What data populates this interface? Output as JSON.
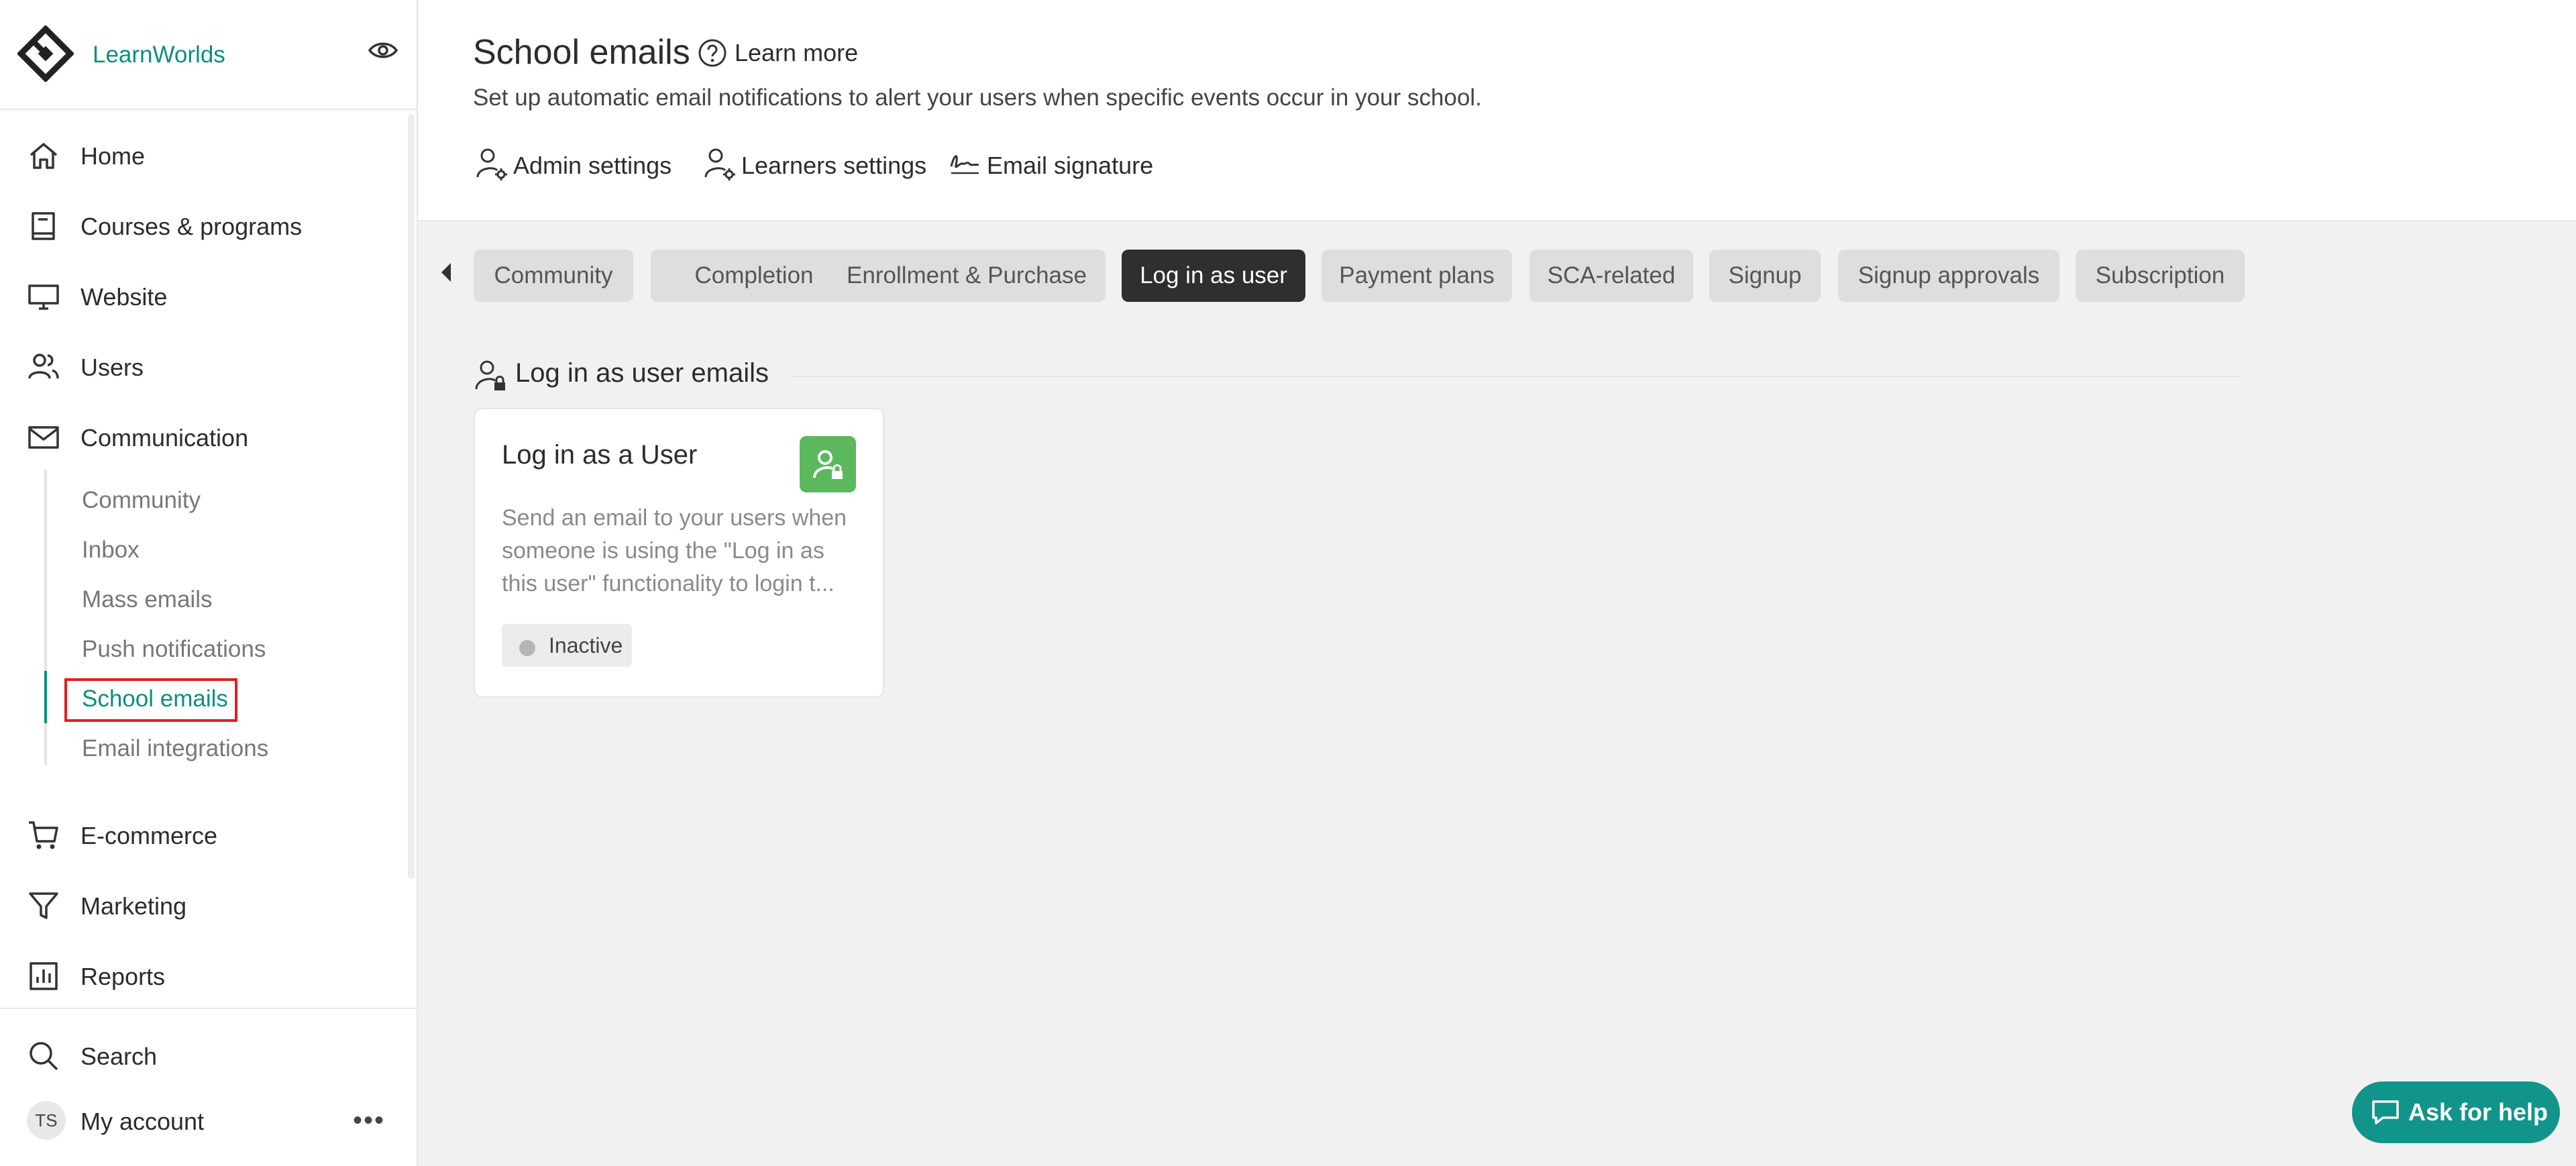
{
  "brand": {
    "name": "LearnWorlds"
  },
  "sidebar": {
    "items": [
      {
        "label": "Home",
        "icon": "home-icon"
      },
      {
        "label": "Courses & programs",
        "icon": "book-icon"
      },
      {
        "label": "Website",
        "icon": "monitor-icon"
      },
      {
        "label": "Users",
        "icon": "users-icon"
      },
      {
        "label": "Communication",
        "icon": "mail-icon"
      },
      {
        "label": "E-commerce",
        "icon": "cart-icon"
      },
      {
        "label": "Marketing",
        "icon": "funnel-icon"
      },
      {
        "label": "Reports",
        "icon": "chart-icon"
      }
    ],
    "communication_sub": [
      "Community",
      "Inbox",
      "Mass emails",
      "Push notifications",
      "School emails",
      "Email integrations"
    ],
    "active_sub": "School emails",
    "search_label": "Search",
    "account_label": "My account",
    "avatar_initials": "TS",
    "more_label": "•••"
  },
  "header": {
    "title": "School emails",
    "learn_more": "Learn more",
    "subtitle": "Set up automatic email notifications to alert your users when specific events occur in your school.",
    "links": [
      "Admin settings",
      "Learners settings",
      "Email signature"
    ]
  },
  "tabs": [
    "Community",
    "Completion",
    "Enrollment & Purchase",
    "Log in as user",
    "Payment plans",
    "SCA-related",
    "Signup",
    "Signup approvals",
    "Subscription"
  ],
  "active_tab": "Log in as user",
  "section": {
    "title": "Log in as user emails"
  },
  "card": {
    "title": "Log in as a User",
    "description": "Send an email to your users when someone is using the \"Log in as this user\" functionality to login t...",
    "status": "Inactive",
    "badge_color": "#5cb85c"
  },
  "help": {
    "label": "Ask for help"
  },
  "colors": {
    "accent": "#0b8f82",
    "active_tab": "#2f2f2f",
    "highlight": "#e02020"
  }
}
